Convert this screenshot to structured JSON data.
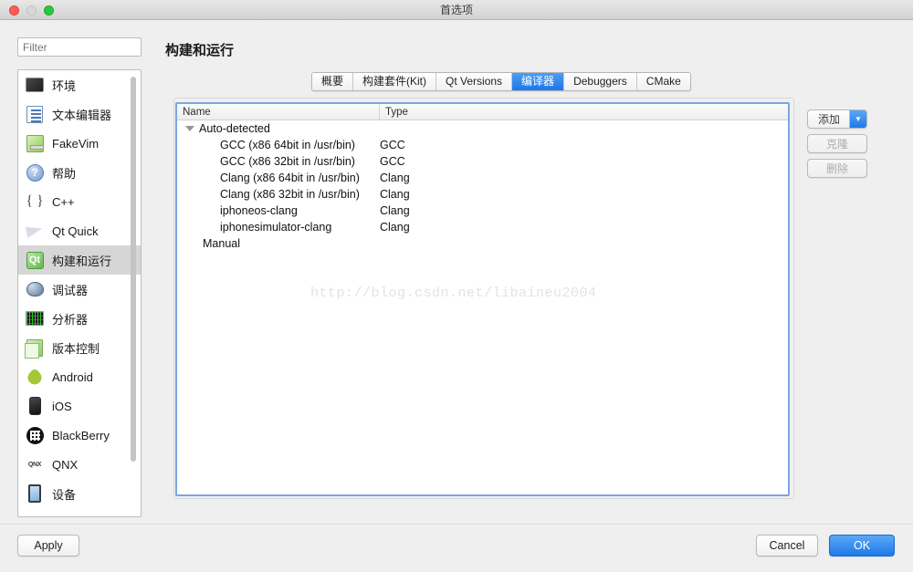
{
  "window": {
    "title": "首选项",
    "controls": {
      "close": "close",
      "minimize": "minimize",
      "zoom": "zoom"
    }
  },
  "sidebar": {
    "filter": {
      "placeholder": "Filter",
      "value": ""
    },
    "items": [
      {
        "label": "环境",
        "icon": "environment-icon",
        "selected": false
      },
      {
        "label": "文本编辑器",
        "icon": "text-editor-icon",
        "selected": false
      },
      {
        "label": "FakeVim",
        "icon": "fakevim-icon",
        "selected": false
      },
      {
        "label": "帮助",
        "icon": "help-icon",
        "selected": false
      },
      {
        "label": "C++",
        "icon": "cpp-icon",
        "selected": false
      },
      {
        "label": "Qt Quick",
        "icon": "qtquick-icon",
        "selected": false
      },
      {
        "label": "构建和运行",
        "icon": "build-and-run-icon",
        "selected": true
      },
      {
        "label": "调试器",
        "icon": "debugger-icon",
        "selected": false
      },
      {
        "label": "分析器",
        "icon": "analyzer-icon",
        "selected": false
      },
      {
        "label": "版本控制",
        "icon": "version-control-icon",
        "selected": false
      },
      {
        "label": "Android",
        "icon": "android-icon",
        "selected": false
      },
      {
        "label": "iOS",
        "icon": "ios-icon",
        "selected": false
      },
      {
        "label": "BlackBerry",
        "icon": "blackberry-icon",
        "selected": false
      },
      {
        "label": "QNX",
        "icon": "qnx-icon",
        "selected": false
      },
      {
        "label": "设备",
        "icon": "devices-icon",
        "selected": false
      }
    ]
  },
  "pane": {
    "title": "构建和运行",
    "tabs": [
      {
        "label": "概要",
        "active": false
      },
      {
        "label": "构建套件(Kit)",
        "active": false
      },
      {
        "label": "Qt Versions",
        "active": false
      },
      {
        "label": "编译器",
        "active": true
      },
      {
        "label": "Debuggers",
        "active": false
      },
      {
        "label": "CMake",
        "active": false
      }
    ]
  },
  "table": {
    "columns": [
      "Name",
      "Type"
    ],
    "rows": [
      {
        "name": "Auto-detected",
        "type": "",
        "level": 0,
        "expanded": true
      },
      {
        "name": "GCC (x86 64bit in /usr/bin)",
        "type": "GCC",
        "level": 1
      },
      {
        "name": "GCC (x86 32bit in /usr/bin)",
        "type": "GCC",
        "level": 1
      },
      {
        "name": "Clang (x86 64bit in /usr/bin)",
        "type": "Clang",
        "level": 1
      },
      {
        "name": "Clang (x86 32bit in /usr/bin)",
        "type": "Clang",
        "level": 1
      },
      {
        "name": "iphoneos-clang",
        "type": "Clang",
        "level": 1
      },
      {
        "name": "iphonesimulator-clang",
        "type": "Clang",
        "level": 1
      },
      {
        "name": "Manual",
        "type": "",
        "level": 0
      }
    ]
  },
  "watermark": "http://blog.csdn.net/libaineu2004",
  "side_buttons": {
    "add": "添加",
    "clone": "克隆",
    "remove": "删除"
  },
  "footer": {
    "apply": "Apply",
    "cancel": "Cancel",
    "ok": "OK"
  },
  "colors": {
    "accent": "#1f79e9",
    "tab_active": "#2a7fec",
    "focus_border": "#7aa7e0",
    "selection": "#d6d6d6"
  }
}
